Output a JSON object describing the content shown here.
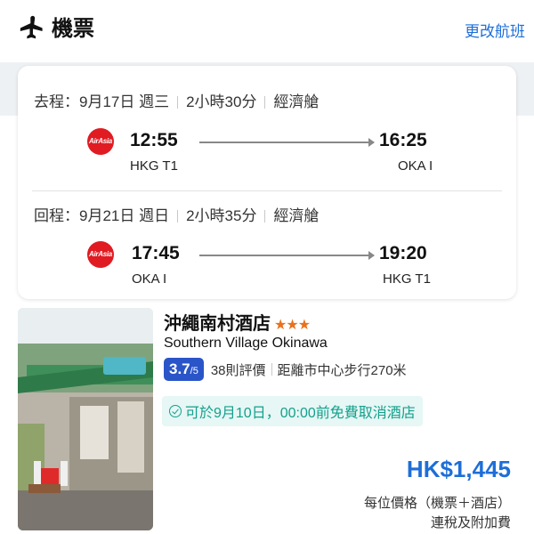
{
  "header": {
    "title": "機票",
    "change_label": "更改航班",
    "icon": "airplane-icon"
  },
  "flights": [
    {
      "header": {
        "direction": "去程：9月17日 週三",
        "duration": "2小時30分",
        "cabin": "經濟艙"
      },
      "airline_logo": "AirAsia",
      "depart_time": "12:55",
      "depart_airport": "HKG T1",
      "arrive_time": "16:25",
      "arrive_airport": "OKA I"
    },
    {
      "header": {
        "direction": "回程：9月21日 週日",
        "duration": "2小時35分",
        "cabin": "經濟艙"
      },
      "airline_logo": "AirAsia",
      "depart_time": "17:45",
      "depart_airport": "OKA I",
      "arrive_time": "19:20",
      "arrive_airport": "HKG T1"
    }
  ],
  "hotel": {
    "name": "沖繩南村酒店",
    "stars": "★★★",
    "star_count": 3,
    "name_en": "Southern Village Okinawa",
    "score": "3.7",
    "score_max": "/5",
    "reviews": "38則評價",
    "distance": "距離市中心步行270米",
    "cancellation": "可於9月10日，00:00前免費取消酒店",
    "price": "HK$1,445",
    "price_note_1": "每位價格（機票＋酒店）",
    "price_note_2": "連稅及附加費"
  },
  "colors": {
    "accent": "#1e6ed8",
    "rating_bg": "#2a55c9",
    "star": "#e8721c",
    "cancel_text": "#14a08c",
    "cancel_bg": "#e6f7f5",
    "airline_red": "#e11b22"
  }
}
